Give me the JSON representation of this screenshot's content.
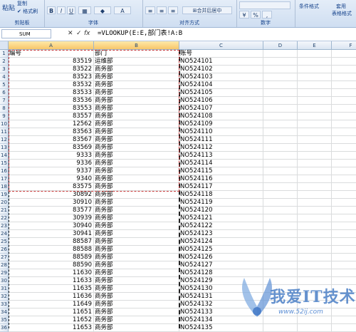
{
  "ribbon": {
    "paste_label": "粘贴",
    "copy_label": "复制",
    "format_painter_label": "格式刷",
    "clipboard_group": "剪贴板",
    "font_group": "字体",
    "align_group": "对齐方式",
    "number_group": "数字",
    "bold": "B",
    "italic": "I",
    "underline": "U",
    "merge_center_label": "合并后居中",
    "percent": "%",
    "conditional_format_label": "条件格式",
    "apply_table_label": "套用",
    "table_format_label": "表格格式"
  },
  "formula_bar": {
    "name_box": "SUM",
    "cancel": "✕",
    "confirm": "✓",
    "fx": "fx",
    "formula": "=VLOOKUP(E:E,部门表!A:B"
  },
  "columns": [
    "A",
    "B",
    "C",
    "D",
    "E",
    "F"
  ],
  "rows": [
    {
      "n": "1",
      "a": "编号",
      "b": "部门",
      "c": "账号"
    },
    {
      "n": "2",
      "a": "83519",
      "b": "运维部",
      "c": "NO524101"
    },
    {
      "n": "3",
      "a": "83522",
      "b": "商务部",
      "c": "NO524102"
    },
    {
      "n": "4",
      "a": "83523",
      "b": "商务部",
      "c": "NO524103"
    },
    {
      "n": "5",
      "a": "83532",
      "b": "商务部",
      "c": "NO524104"
    },
    {
      "n": "6",
      "a": "83533",
      "b": "商务部",
      "c": "NO524105"
    },
    {
      "n": "7",
      "a": "83536",
      "b": "商务部",
      "c": "NO524106"
    },
    {
      "n": "8",
      "a": "83553",
      "b": "商务部",
      "c": "NO524107"
    },
    {
      "n": "9",
      "a": "83557",
      "b": "商务部",
      "c": "NO524108"
    },
    {
      "n": "10",
      "a": "12562",
      "b": "商务部",
      "c": "NO524109"
    },
    {
      "n": "11",
      "a": "83563",
      "b": "商务部",
      "c": "NO524110"
    },
    {
      "n": "12",
      "a": "83567",
      "b": "商务部",
      "c": "NO524111"
    },
    {
      "n": "13",
      "a": "83569",
      "b": "商务部",
      "c": "NO524112"
    },
    {
      "n": "14",
      "a": "9333",
      "b": "商务部",
      "c": "NO524113"
    },
    {
      "n": "15",
      "a": "9336",
      "b": "商务部",
      "c": "NO524114"
    },
    {
      "n": "16",
      "a": "9337",
      "b": "商务部",
      "c": "NO524115"
    },
    {
      "n": "17",
      "a": "9340",
      "b": "商务部",
      "c": "NO524116"
    },
    {
      "n": "18",
      "a": "83575",
      "b": "商务部",
      "c": "NO524117"
    },
    {
      "n": "19",
      "a": "30892",
      "b": "商务部",
      "c": "NO524118"
    },
    {
      "n": "20",
      "a": "30910",
      "b": "商务部",
      "c": "NO524119"
    },
    {
      "n": "21",
      "a": "83577",
      "b": "商务部",
      "c": "NO524120"
    },
    {
      "n": "22",
      "a": "30939",
      "b": "商务部",
      "c": "NO524121"
    },
    {
      "n": "23",
      "a": "30940",
      "b": "商务部",
      "c": "NO524122"
    },
    {
      "n": "24",
      "a": "30941",
      "b": "商务部",
      "c": "NO524123"
    },
    {
      "n": "25",
      "a": "88587",
      "b": "商务部",
      "c": "NO524124"
    },
    {
      "n": "26",
      "a": "88588",
      "b": "商务部",
      "c": "NO524125"
    },
    {
      "n": "27",
      "a": "88589",
      "b": "商务部",
      "c": "NO524126"
    },
    {
      "n": "28",
      "a": "88590",
      "b": "商务部",
      "c": "NO524127"
    },
    {
      "n": "29",
      "a": "11630",
      "b": "商务部",
      "c": "NO524128"
    },
    {
      "n": "30",
      "a": "11633",
      "b": "商务部",
      "c": "NO524129"
    },
    {
      "n": "31",
      "a": "11635",
      "b": "商务部",
      "c": "NO524130"
    },
    {
      "n": "32",
      "a": "11636",
      "b": "商务部",
      "c": "NO524131"
    },
    {
      "n": "33",
      "a": "11649",
      "b": "商务部",
      "c": "NO524132"
    },
    {
      "n": "34",
      "a": "11651",
      "b": "商务部",
      "c": "NO524133"
    },
    {
      "n": "35",
      "a": "11652",
      "b": "商务部",
      "c": "NO524134"
    },
    {
      "n": "36",
      "a": "11653",
      "b": "商务部",
      "c": "NO524135"
    }
  ],
  "watermark": {
    "text": "我爱IT技术网",
    "url": "www.52ij.com"
  },
  "colors": {
    "marquee": "#c83b3b",
    "ribbon": "#dbe6f4"
  }
}
